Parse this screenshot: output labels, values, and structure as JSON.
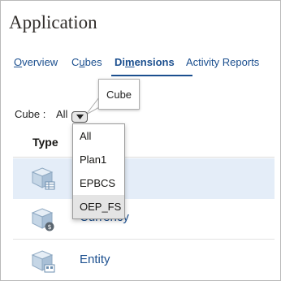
{
  "app": {
    "title": "Application"
  },
  "tabs": [
    {
      "label": "Overview",
      "accel": "O",
      "rest": "verview"
    },
    {
      "label": "Cubes",
      "pre": "C",
      "accel": "u",
      "rest": "bes"
    },
    {
      "label": "Dimensions",
      "pre": "Di",
      "accel": "m",
      "rest": "ensions"
    },
    {
      "label": "Activity Reports"
    }
  ],
  "active_tab": "Dimensions",
  "tooltip": {
    "text": "Cube"
  },
  "filter": {
    "label": "Cube :",
    "value": "All"
  },
  "menu": {
    "options": [
      "All",
      "Plan1",
      "EPBCS",
      "OEP_FS"
    ],
    "highlighted": "OEP_FS"
  },
  "table": {
    "column_header": "Type",
    "rows": [
      {
        "name": "",
        "icon": "cube-table-icon"
      },
      {
        "name": "Currency",
        "icon": "cube-currency-icon"
      },
      {
        "name": "Entity",
        "icon": "cube-entity-icon"
      }
    ]
  },
  "colors": {
    "link": "#1b4f8f",
    "selected_row": "#e4edf8",
    "menu_hover": "#e4e4e4"
  }
}
